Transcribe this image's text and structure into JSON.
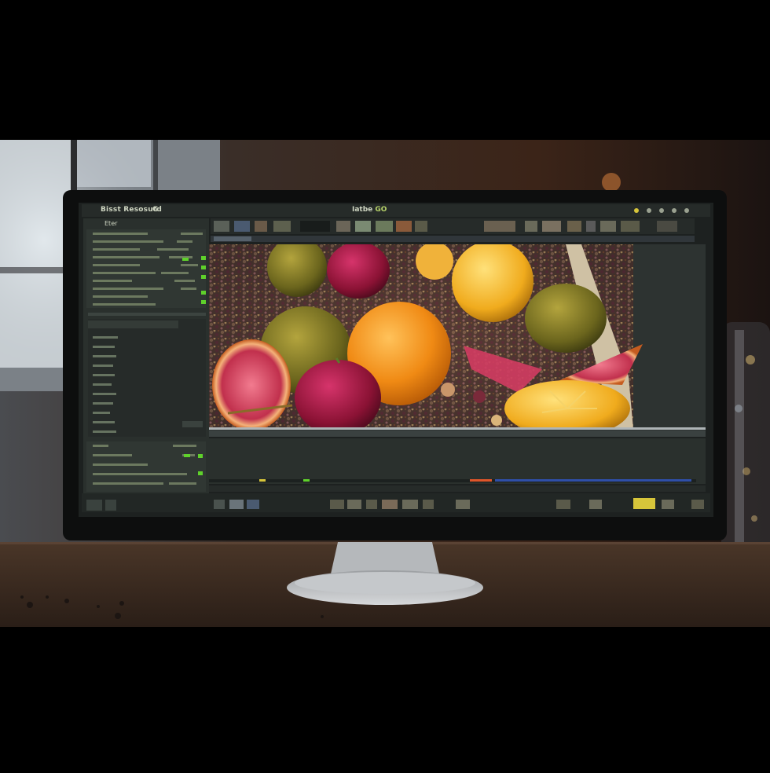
{
  "app": {
    "title_left": "Bisst Resosutd",
    "title_left_glyph": "G",
    "title_center": "Iatbe",
    "title_center_num": "GO"
  },
  "panel": {
    "filter_label": "Eter"
  },
  "colors": {
    "accent_green": "#5fd12b",
    "accent_yellow": "#d7c53a",
    "timeline_orange": "#e0552a",
    "timeline_blue": "#2f4fa8",
    "ui_bg": "#2c3130",
    "screen_frame": "#141515"
  },
  "icons": [
    "monitor-stand",
    "window-light",
    "bokeh-lights",
    "fruit-photo"
  ]
}
